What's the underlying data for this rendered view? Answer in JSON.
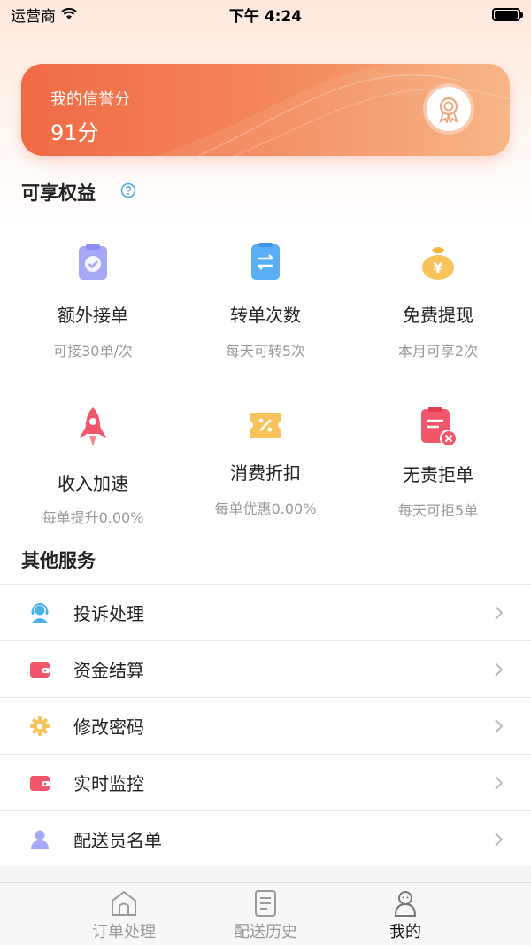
{
  "status_bar": {
    "carrier": "运营商",
    "time": "下午 4:24"
  },
  "credit_card": {
    "label": "我的信誉分",
    "score": "91分",
    "badge_icon": "award-medal-icon"
  },
  "benefits_section": {
    "title": "可享权益",
    "help_icon": "question-circle-icon",
    "items": [
      {
        "icon": "clipboard-check-icon",
        "color": "#a7a8f5",
        "name": "额外接单",
        "desc": "可接30单/次"
      },
      {
        "icon": "transfer-card-icon",
        "color": "#5aaef5",
        "name": "转单次数",
        "desc": "每天可转5次"
      },
      {
        "icon": "money-bag-icon",
        "color": "#f9c25a",
        "name": "免费提现",
        "desc": "本月可享2次"
      },
      {
        "icon": "rocket-icon",
        "color": "#f2566a",
        "name": "收入加速",
        "desc": "每单提升0.00%"
      },
      {
        "icon": "discount-ticket-icon",
        "color": "#f9c25a",
        "name": "消费折扣",
        "desc": "每单优惠0.00%"
      },
      {
        "icon": "reject-clipboard-icon",
        "color": "#f2566a",
        "name": "无责拒单",
        "desc": "每天可拒5单"
      }
    ]
  },
  "other_services": {
    "title": "其他服务",
    "items": [
      {
        "icon": "customer-service-icon",
        "color": "#4ab2e8",
        "label": "投诉处理"
      },
      {
        "icon": "wallet-icon",
        "color": "#f2566a",
        "label": "资金结算"
      },
      {
        "icon": "gear-icon",
        "color": "#f9c25a",
        "label": "修改密码"
      },
      {
        "icon": "wallet-icon",
        "color": "#f2566a",
        "label": "实时监控"
      },
      {
        "icon": "user-icon",
        "color": "#a7a8f5",
        "label": "配送员名单"
      }
    ]
  },
  "tab_bar": {
    "tabs": [
      {
        "icon": "home-icon",
        "label": "订单处理",
        "active": false
      },
      {
        "icon": "document-icon",
        "label": "配送历史",
        "active": false
      },
      {
        "icon": "profile-icon",
        "label": "我的",
        "active": true
      }
    ]
  }
}
